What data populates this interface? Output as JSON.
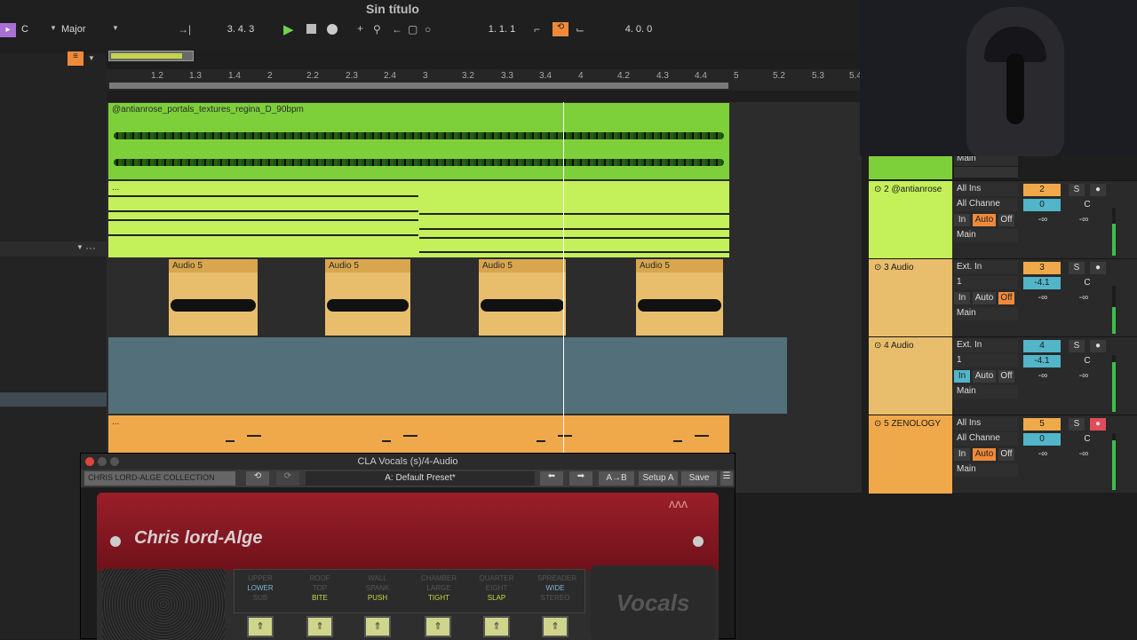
{
  "app": {
    "title": "Sin título"
  },
  "toolbar": {
    "scale_key": "C",
    "scale_mode": "Major",
    "position": "3. 4. 3",
    "loop_start": "1. 1. 1",
    "loop_length": "4. 0. 0"
  },
  "ruler": {
    "ticks": [
      "1.2",
      "1.3",
      "1.4",
      "2",
      "2.2",
      "2.3",
      "2.4",
      "3",
      "3.2",
      "3.3",
      "3.4",
      "4",
      "4.2",
      "4.3",
      "4.4",
      "5",
      "5.2",
      "5.3",
      "5.4"
    ]
  },
  "clips": {
    "track1": "@antianrose_portals_textures_regina_D_90bpm",
    "track2": "...",
    "audio5": [
      "Audio 5",
      "Audio 5",
      "Audio 5",
      "Audio 5"
    ],
    "track5": "..."
  },
  "mixer": {
    "top_output": "Main",
    "tracks": [
      {
        "name": "2 @antianrose",
        "input": "All Ins",
        "channel": "All Channe",
        "number": "2",
        "send": "0",
        "pan": "C",
        "in": "In",
        "auto": "Auto",
        "off": "Off",
        "vol": "-∞",
        "vol2": "-∞",
        "output": "Main"
      },
      {
        "name": "3 Audio",
        "input": "Ext. In",
        "channel": "1",
        "number": "3",
        "send": "-4.1",
        "pan": "C",
        "in": "In",
        "auto": "Auto",
        "off": "Off",
        "vol": "-∞",
        "vol2": "-∞",
        "output": "Main"
      },
      {
        "name": "4 Audio",
        "input": "Ext. In",
        "channel": "1",
        "number": "4",
        "send": "-4.1",
        "pan": "C",
        "in": "In",
        "auto": "Auto",
        "off": "Off",
        "vol": "-∞",
        "vol2": "-∞",
        "output": "Main"
      },
      {
        "name": "5 ZENOLOGY",
        "input": "All Ins",
        "channel": "All Channe",
        "number": "5",
        "send": "0",
        "pan": "C",
        "in": "In",
        "auto": "Auto",
        "off": "Off",
        "vol": "-∞",
        "vol2": "-∞",
        "output": "Main"
      }
    ],
    "solo": "S"
  },
  "plugin": {
    "window_title": "CLA Vocals (s)/4-Audio",
    "collection": "CHRIS LORD-ALGE COLLECTION",
    "preset": "A: Default Preset*",
    "ab": "A→B",
    "setup": "Setup A",
    "save": "Save",
    "brand": "Chris lord-Alge",
    "badge": "Vocals",
    "knobs": [
      {
        "top": "UPPER",
        "mid": "LOWER",
        "bot": "SUB"
      },
      {
        "top": "ROOF",
        "mid": "TOP",
        "bot": "BITE"
      },
      {
        "top": "WALL",
        "mid": "SPANK",
        "bot": "PUSH"
      },
      {
        "top": "CHAMBER",
        "mid": "LARGE",
        "bot": "TIGHT"
      },
      {
        "top": "QUARTER",
        "mid": "EIGHT",
        "bot": "SLAP"
      },
      {
        "top": "SPREADER",
        "mid": "WIDE",
        "bot": "STEREO"
      }
    ]
  },
  "colors": {
    "green": "#7ed03a",
    "lime": "#c4f05a",
    "orange": "#f0a94a",
    "teal": "#53707a",
    "accent": "#f08a3a"
  }
}
